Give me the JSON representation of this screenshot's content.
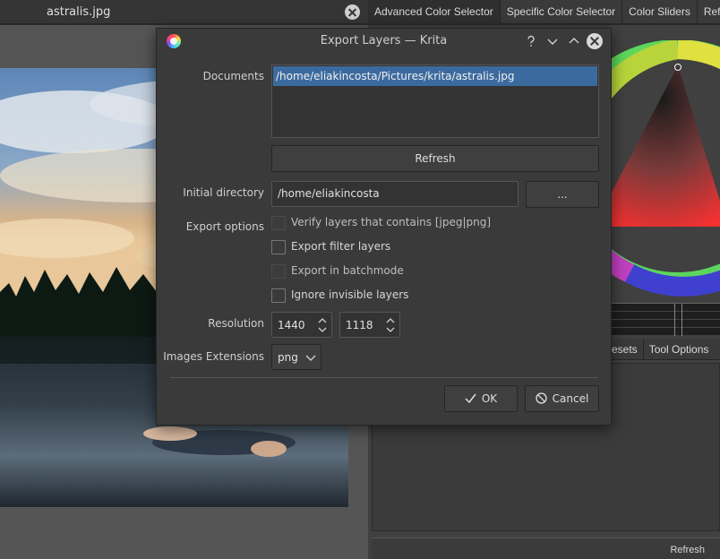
{
  "document_tab": {
    "title": "astralis.jpg"
  },
  "right_tabs": [
    "Advanced Color Selector",
    "Specific Color Selector",
    "Color Sliders",
    "Refere"
  ],
  "docker_tabs": [
    "esets",
    "Tool Options"
  ],
  "bottom_strip": {
    "refresh_label": "Refresh"
  },
  "dialog": {
    "title": "Export Layers — Krita",
    "labels": {
      "documents": "Documents",
      "initial_directory": "Initial directory",
      "export_options": "Export options",
      "resolution": "Resolution",
      "images_extensions": "Images Extensions"
    },
    "documents": [
      "/home/eliakincosta/Pictures/krita/astralis.jpg"
    ],
    "refresh_button": "Refresh",
    "initial_directory_value": "/home/eliakincosta",
    "browse_button": "...",
    "options": [
      {
        "label": "Verify layers that contains [jpeg|png]",
        "checked": false,
        "enabled": false
      },
      {
        "label": "Export filter layers",
        "checked": false,
        "enabled": true
      },
      {
        "label": "Export in batchmode",
        "checked": false,
        "enabled": false
      },
      {
        "label": "Ignore invisible layers",
        "checked": false,
        "enabled": true
      }
    ],
    "resolution": {
      "width": "1440",
      "height": "1118"
    },
    "images_extension": "png",
    "ok_button": "OK",
    "cancel_button": "Cancel"
  },
  "icons": {
    "app": "krita-icon",
    "help": "help-icon",
    "minimize": "minimize-icon",
    "maximize": "maximize-icon",
    "close": "close-icon",
    "ok": "check-icon",
    "cancel": "cancel-icon"
  },
  "colors": {
    "dialog_bg": "#3a3a3a",
    "selection": "#3b6a9e",
    "field_bg": "#333333",
    "window_bg": "#404040"
  }
}
